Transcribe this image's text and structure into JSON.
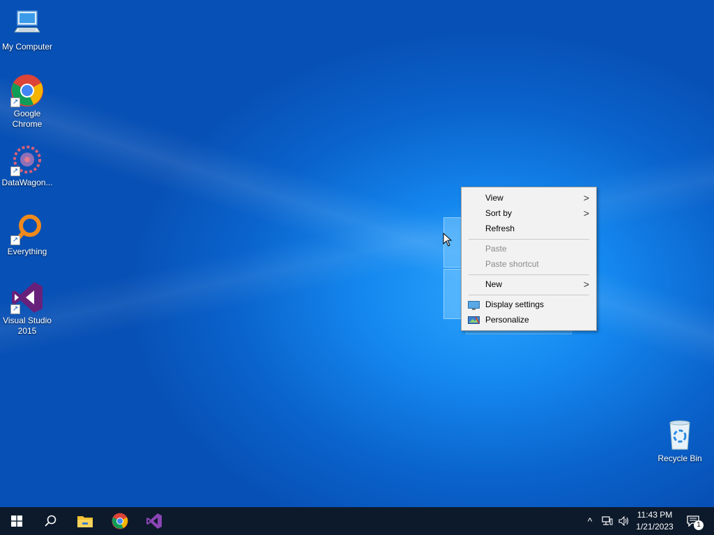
{
  "desktop": {
    "icons": [
      {
        "label": "My Computer"
      },
      {
        "label": "Google Chrome"
      },
      {
        "label": "DataWagon..."
      },
      {
        "label": "Everything"
      },
      {
        "label": "Visual Studio 2015"
      },
      {
        "label": "Recycle Bin"
      }
    ]
  },
  "context_menu": {
    "items": [
      {
        "label": "View",
        "submenu": true,
        "enabled": true
      },
      {
        "label": "Sort by",
        "submenu": true,
        "enabled": true
      },
      {
        "label": "Refresh",
        "submenu": false,
        "enabled": true
      },
      {
        "label": "Paste",
        "submenu": false,
        "enabled": false
      },
      {
        "label": "Paste shortcut",
        "submenu": false,
        "enabled": false
      },
      {
        "label": "New",
        "submenu": true,
        "enabled": true
      },
      {
        "label": "Display settings",
        "submenu": false,
        "enabled": true,
        "icon": "display-icon"
      },
      {
        "label": "Personalize",
        "submenu": false,
        "enabled": true,
        "icon": "personalize-icon"
      }
    ],
    "submenu_glyph": ">"
  },
  "taskbar": {
    "pinned": [
      "start-icon",
      "search-icon",
      "file-explorer-icon",
      "chrome-icon",
      "visual-studio-icon"
    ],
    "tray_icons": [
      "chevron-up-icon",
      "network-icon",
      "volume-icon"
    ],
    "tray_chevron": "^",
    "time": "11:43 PM",
    "date": "1/21/2023",
    "notification_count": "1"
  },
  "colors": {
    "desktop_blue": "#1487ee",
    "taskbar": "#0d1a2b",
    "menu_bg": "#f2f2f2",
    "disabled_text": "#8a8a8a"
  }
}
